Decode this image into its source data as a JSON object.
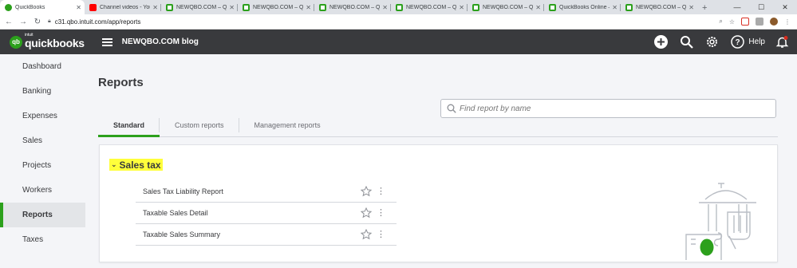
{
  "browser": {
    "tabs": [
      {
        "title": "QuickBooks",
        "favicon": "quickbooks-icon",
        "active": true
      },
      {
        "title": "Channel videos - YouTube",
        "favicon": "youtube-icon"
      },
      {
        "title": "NEWQBO.COM – Quick",
        "favicon": "newqbo-icon"
      },
      {
        "title": "NEWQBO.COM – Quick",
        "favicon": "newqbo-icon"
      },
      {
        "title": "NEWQBO.COM – Quick",
        "favicon": "newqbo-icon"
      },
      {
        "title": "NEWQBO.COM – Quick",
        "favicon": "newqbo-icon"
      },
      {
        "title": "NEWQBO.COM – Quick",
        "favicon": "newqbo-icon"
      },
      {
        "title": "QuickBooks Online – ",
        "favicon": "newqbo-icon"
      },
      {
        "title": "NEWQBO.COM – Quick",
        "favicon": "newqbo-icon"
      }
    ],
    "url": "c31.qbo.intuit.com/app/reports"
  },
  "header": {
    "intuit": "intuit",
    "brand": "quickbooks",
    "company": "NEWQBO.COM blog",
    "help": "Help"
  },
  "sidebar": {
    "items": [
      {
        "label": "Dashboard"
      },
      {
        "label": "Banking"
      },
      {
        "label": "Expenses"
      },
      {
        "label": "Sales"
      },
      {
        "label": "Projects"
      },
      {
        "label": "Workers"
      },
      {
        "label": "Reports",
        "active": true
      },
      {
        "label": "Taxes"
      }
    ]
  },
  "main": {
    "title": "Reports",
    "search_placeholder": "Find report by name",
    "tabs": [
      {
        "label": "Standard",
        "active": true
      },
      {
        "label": "Custom reports"
      },
      {
        "label": "Management reports"
      }
    ],
    "section": {
      "title": "Sales tax",
      "reports": [
        {
          "label": "Sales Tax Liability Report"
        },
        {
          "label": "Taxable Sales Detail"
        },
        {
          "label": "Taxable Sales Summary"
        }
      ]
    }
  },
  "colors": {
    "brand_green": "#2ca01c",
    "header_bg": "#393a3d",
    "highlight": "#ffff3b"
  }
}
